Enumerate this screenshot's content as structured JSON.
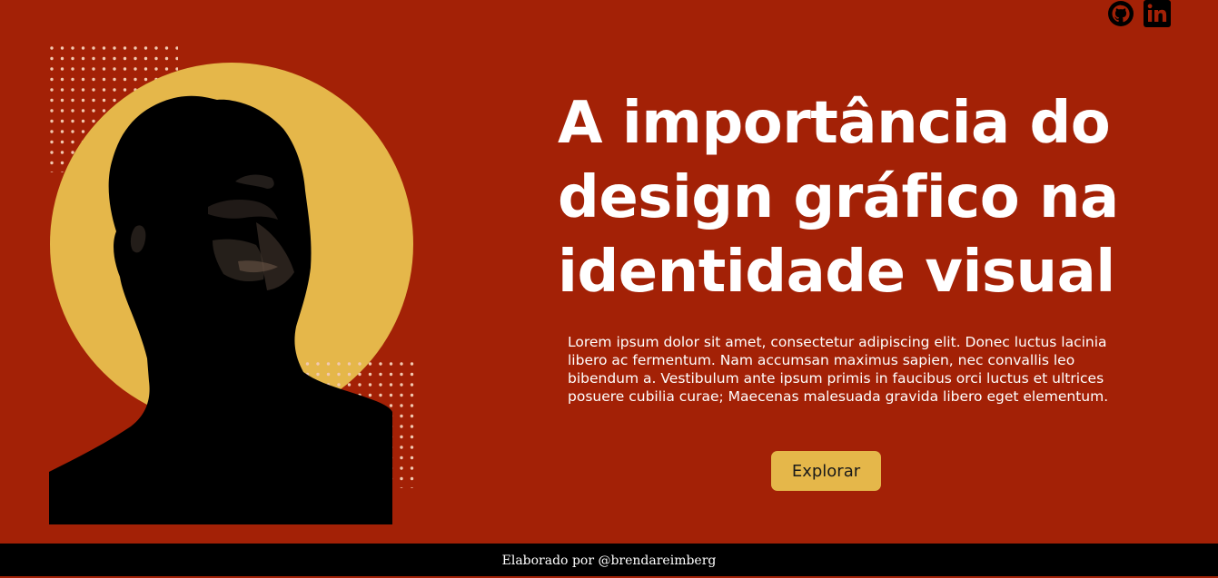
{
  "social": {
    "github_icon": "github-icon",
    "linkedin_icon": "linkedin-icon"
  },
  "hero": {
    "title": "A importância do design gráfico na identidade visual",
    "description": "Lorem ipsum dolor sit amet, consectetur adipiscing elit. Donec luctus lacinia libero ac fermentum. Nam accumsan maximus sapien, nec convallis leo bibendum a. Vestibulum ante ipsum primis in faucibus orci luctus et ultrices posuere cubilia curae; Maecenas malesuada gravida libero eget elementum.",
    "button_label": "Explorar"
  },
  "footer": {
    "credit": "Elaborado por @brendareimberg"
  },
  "colors": {
    "background": "#a32106",
    "accent": "#e5b74a",
    "text": "#ffffff",
    "footer_background": "#000000"
  }
}
